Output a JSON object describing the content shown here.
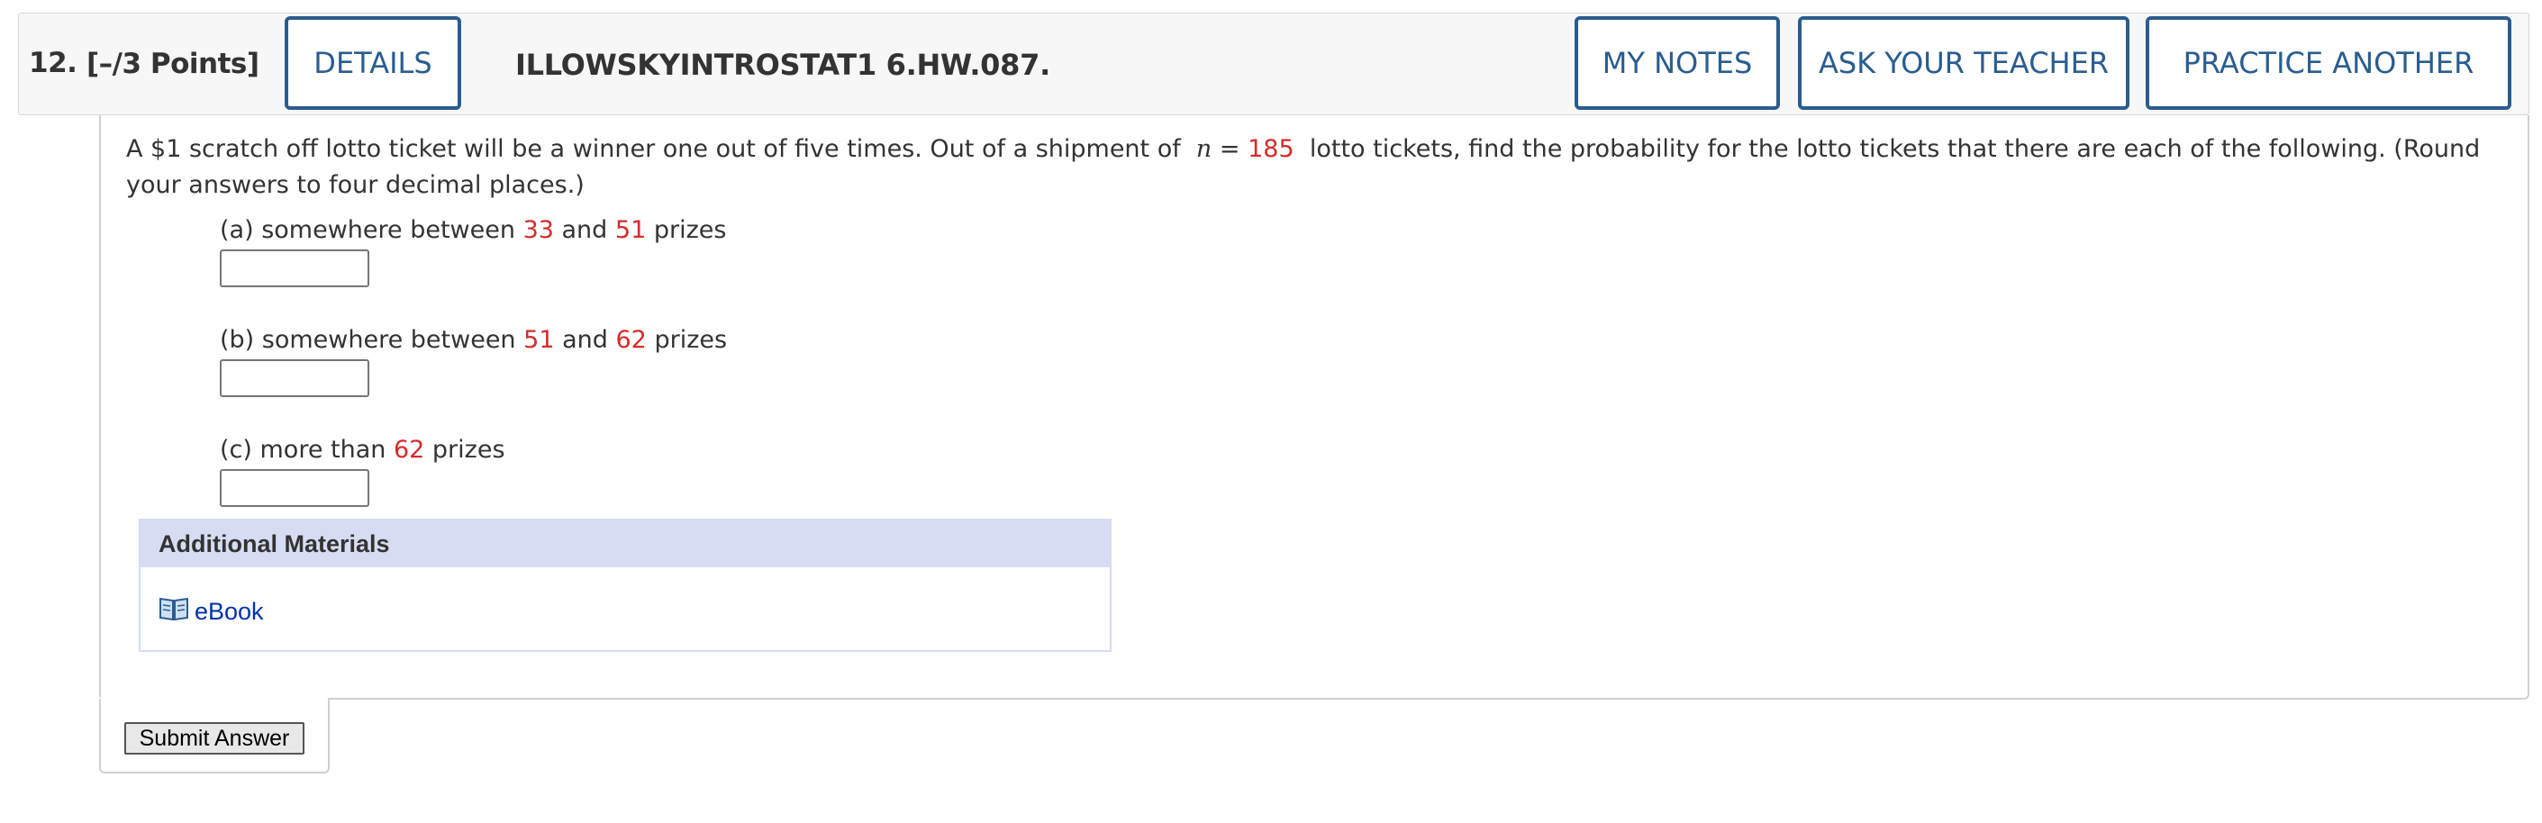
{
  "question": {
    "number": "12.",
    "points": "[–/3 Points]",
    "details_label": "DETAILS",
    "assignment_id": "ILLOWSKYINTROSTAT1 6.HW.087.",
    "my_notes_label": "MY NOTES",
    "ask_teacher_label": "ASK YOUR TEACHER",
    "practice_label": "PRACTICE ANOTHER"
  },
  "problem": {
    "text_before": "A $1 scratch off lotto ticket will be a winner one out of five times. Out of a shipment of",
    "var_n": "n",
    "equals": "=",
    "n_value": "185",
    "text_after": "lotto tickets, find the probability for the lotto tickets that there are each of the following. (Round your answers to four decimal places.)"
  },
  "parts": [
    {
      "label": "(a) somewhere between",
      "v1": "33",
      "mid": "and",
      "v2": "51",
      "end": "prizes",
      "answer": ""
    },
    {
      "label": "(b) somewhere between",
      "v1": "51",
      "mid": "and",
      "v2": "62",
      "end": "prizes",
      "answer": ""
    },
    {
      "label": "(c) more than",
      "v1": "62",
      "end": "prizes",
      "answer": ""
    }
  ],
  "additional": {
    "title": "Additional Materials",
    "ebook_label": "eBook",
    "ebook_icon": "book-icon"
  },
  "submit_label": "Submit Answer",
  "colors": {
    "accent": "#2a5d8f",
    "value_red": "#d62b2b",
    "link": "#0033aa",
    "addl_header": "#d6ddf3"
  }
}
